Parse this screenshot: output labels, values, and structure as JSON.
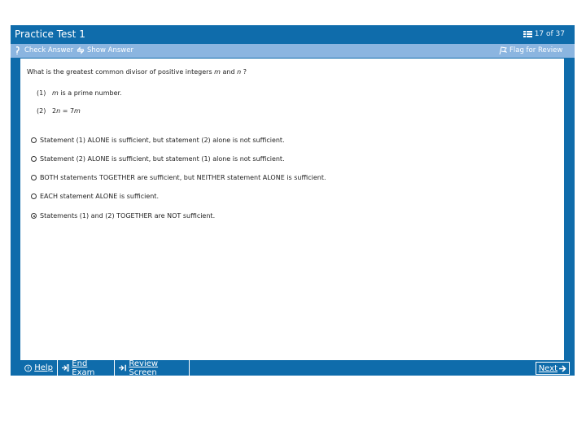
{
  "window": {
    "title": "Practice Test 1",
    "counter": "17 of 37"
  },
  "toolbar": {
    "check_answer": "Check Answer",
    "show_answer": "Show Answer",
    "flag_review": "Flag for Review"
  },
  "question": {
    "prompt_prefix": "What is the greatest common divisor of positive integers ",
    "var_m": "m",
    "prompt_and": " and ",
    "var_n": "n",
    "prompt_suffix": " ?",
    "statement1_num": "(1)",
    "statement1_var": "m",
    "statement1_text": " is a prime number.",
    "statement2_num": "(2)",
    "statement2_lhs": "2",
    "statement2_lhs_var": "n",
    "statement2_eq": " = 7",
    "statement2_rhs_var": "m"
  },
  "options": [
    {
      "label": "Statement (1) ALONE is sufficient, but statement (2) alone is not sufficient.",
      "selected": false
    },
    {
      "label": "Statement (2) ALONE is sufficient, but statement (1) alone is not sufficient.",
      "selected": false
    },
    {
      "label": "BOTH statements TOGETHER are sufficient, but NEITHER statement ALONE is sufficient.",
      "selected": false
    },
    {
      "label": "EACH statement ALONE is sufficient.",
      "selected": false
    },
    {
      "label": "Statements (1) and (2) TOGETHER are NOT sufficient.",
      "selected": true
    }
  ],
  "bottombar": {
    "help": "Help",
    "end_exam": "End Exam",
    "review_screen": "Review Screen",
    "next": "Next"
  },
  "colors": {
    "frame": "#0f6cab",
    "toolbar": "#8bb5e0",
    "content_bg": "#ffffff"
  },
  "icons": [
    "list-icon",
    "check-answer-icon",
    "show-answer-icon",
    "flag-icon",
    "help-icon",
    "end-exam-icon",
    "review-screen-icon",
    "next-arrow-icon"
  ]
}
